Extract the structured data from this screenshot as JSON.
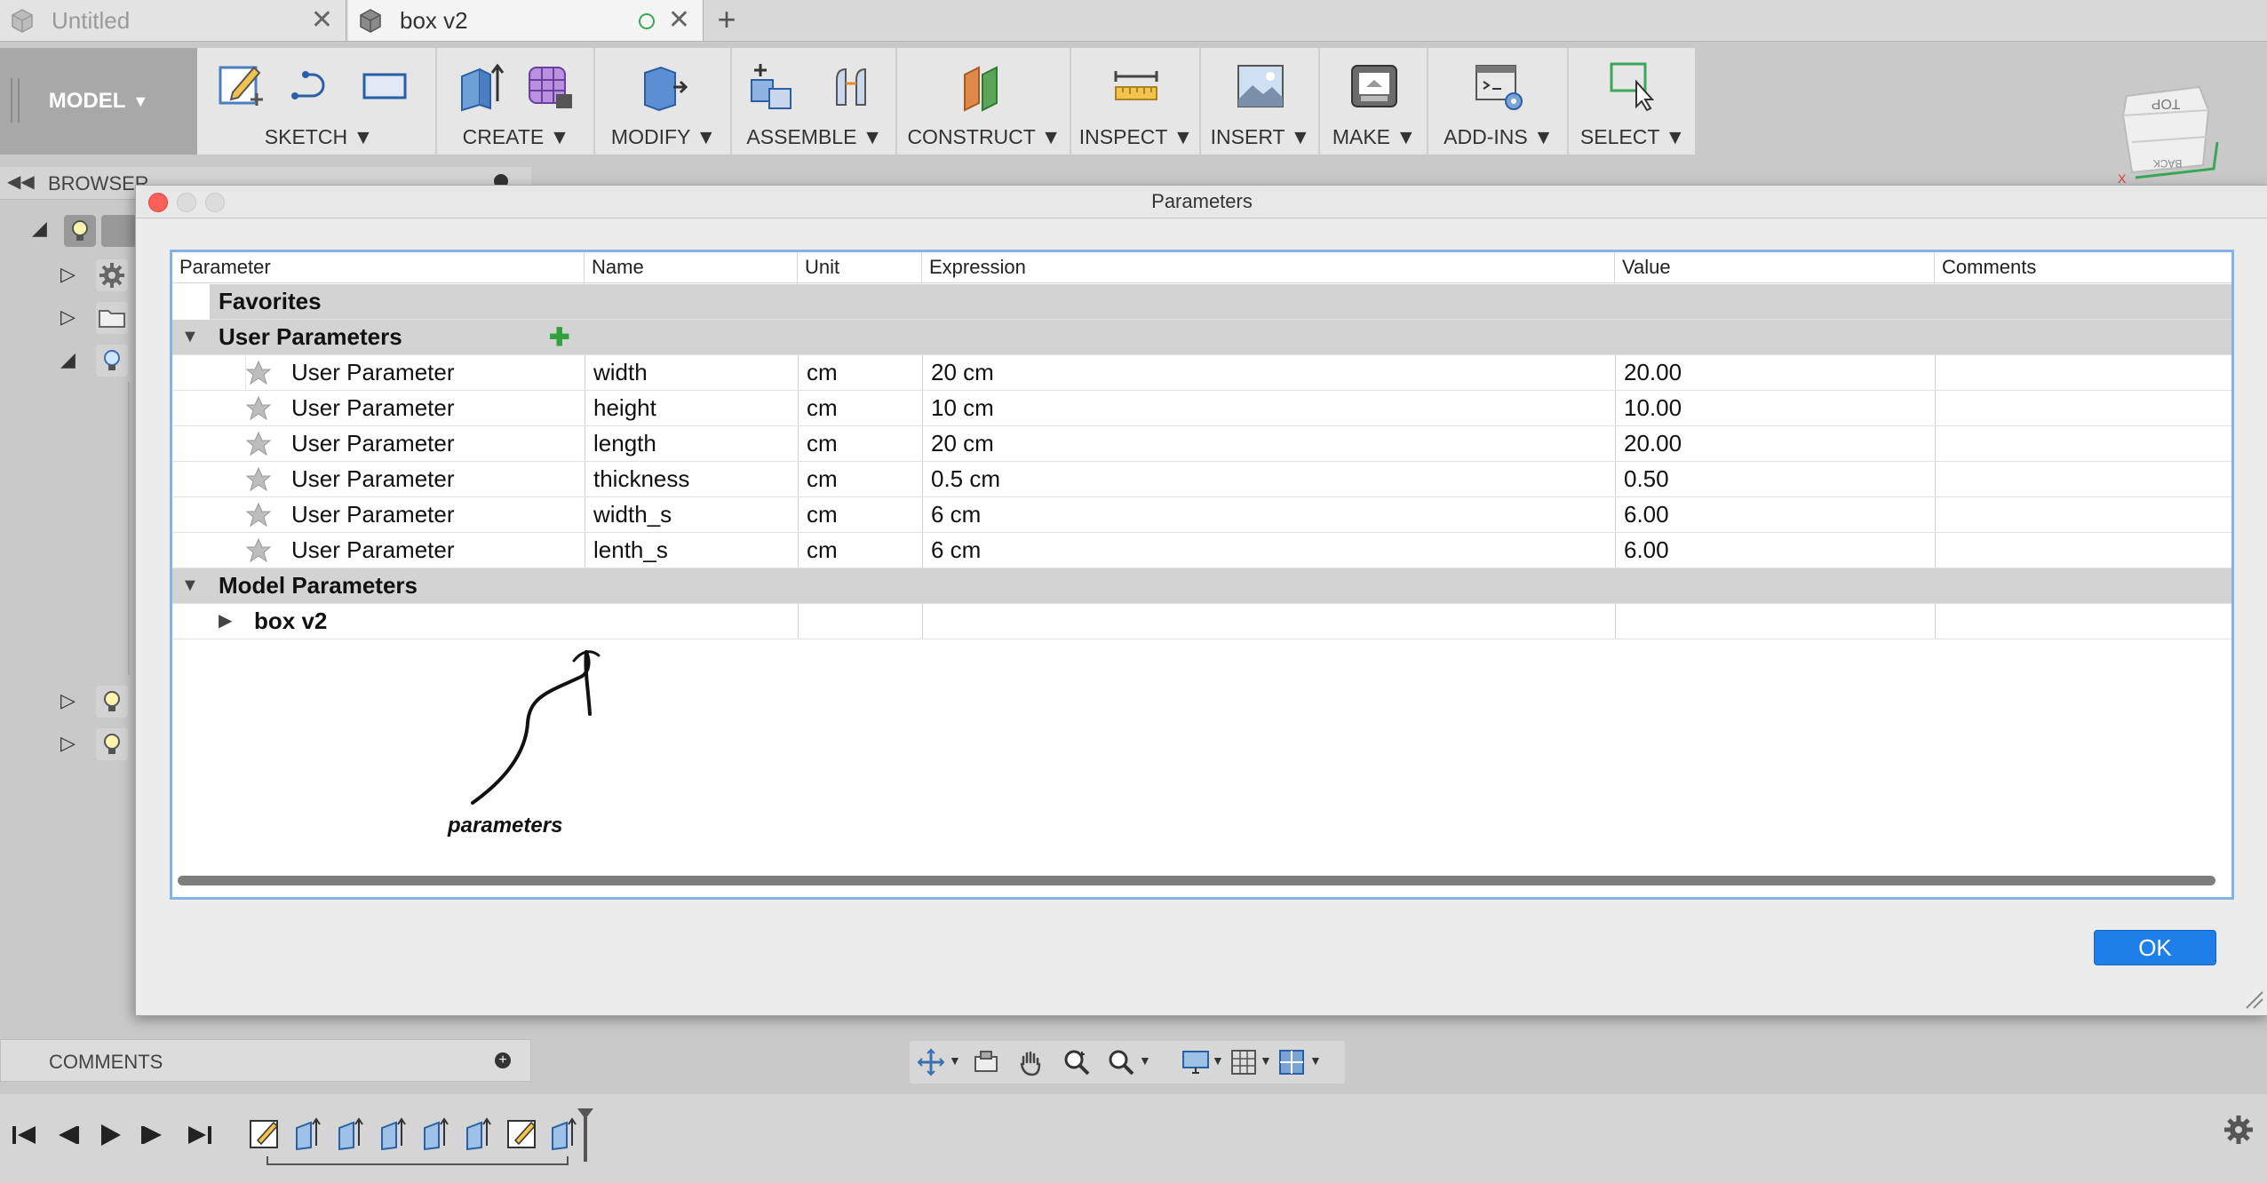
{
  "tabs": [
    {
      "label": "Untitled"
    },
    {
      "label": "box v2"
    }
  ],
  "toolbar": {
    "workspace": "MODEL",
    "groups": [
      {
        "label": "SKETCH"
      },
      {
        "label": "CREATE"
      },
      {
        "label": "MODIFY"
      },
      {
        "label": "ASSEMBLE"
      },
      {
        "label": "CONSTRUCT"
      },
      {
        "label": "INSPECT"
      },
      {
        "label": "INSERT"
      },
      {
        "label": "MAKE"
      },
      {
        "label": "ADD-INS"
      },
      {
        "label": "SELECT"
      }
    ]
  },
  "viewcube": {
    "top": "TOP",
    "back": "BACK"
  },
  "browser": {
    "title": "BROWSER"
  },
  "dialog": {
    "title": "Parameters",
    "columns": [
      "Parameter",
      "Name",
      "Unit",
      "Expression",
      "Value",
      "Comments"
    ],
    "favorites_label": "Favorites",
    "user_params_label": "User Parameters",
    "model_params_label": "Model Parameters",
    "model_child": "box v2",
    "user_params": [
      {
        "type": "User Parameter",
        "name": "width",
        "unit": "cm",
        "expression": "20 cm",
        "value": "20.00",
        "comment": ""
      },
      {
        "type": "User Parameter",
        "name": "height",
        "unit": "cm",
        "expression": "10 cm",
        "value": "10.00",
        "comment": ""
      },
      {
        "type": "User Parameter",
        "name": "length",
        "unit": "cm",
        "expression": "20 cm",
        "value": "20.00",
        "comment": ""
      },
      {
        "type": "User Parameter",
        "name": "thickness",
        "unit": "cm",
        "expression": "0.5 cm",
        "value": "0.50",
        "comment": ""
      },
      {
        "type": "User Parameter",
        "name": "width_s",
        "unit": "cm",
        "expression": "6 cm",
        "value": "6.00",
        "comment": ""
      },
      {
        "type": "User Parameter",
        "name": "lenth_s",
        "unit": "cm",
        "expression": "6 cm",
        "value": "6.00",
        "comment": ""
      }
    ],
    "annotation": "parameters",
    "ok_label": "OK"
  },
  "comments": {
    "title": "COMMENTS"
  },
  "colors": {
    "accent": "#1e7fe8",
    "close": "#fc5f57",
    "add": "#3aa757",
    "frame": "#84b4e6"
  }
}
